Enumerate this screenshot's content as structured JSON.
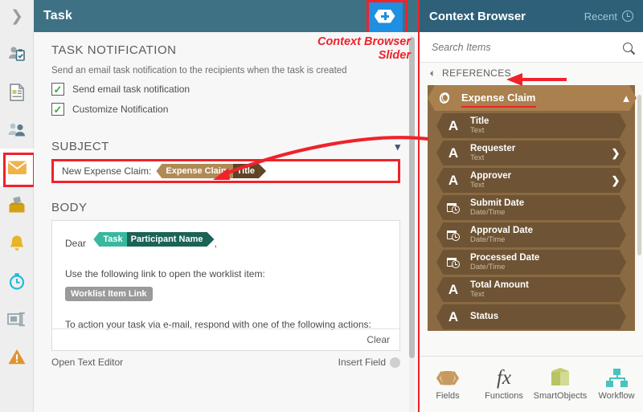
{
  "rail": {
    "collapse_icon": "chevron-right-icon",
    "items": [
      {
        "name": "users-tasks-icon",
        "label": "Users and Tasks",
        "selected": false
      },
      {
        "name": "form-icon",
        "label": "Form",
        "selected": false
      },
      {
        "name": "participants-icon",
        "label": "Participants",
        "selected": false
      },
      {
        "name": "email-icon",
        "label": "Email Notification",
        "selected": true
      },
      {
        "name": "inbox-icon",
        "label": "Inbox",
        "selected": false
      },
      {
        "name": "bell-icon",
        "label": "Reminders",
        "selected": false
      },
      {
        "name": "timer-icon",
        "label": "Escalations",
        "selected": false
      },
      {
        "name": "rules-icon",
        "label": "Rules",
        "selected": false
      },
      {
        "name": "warning-icon",
        "label": "Exceptions",
        "selected": false
      }
    ]
  },
  "main": {
    "title": "Task",
    "slider_icon": "hexagon-plus-icon",
    "notification": {
      "section_title": "TASK NOTIFICATION",
      "description": "Send an email task notification to the recipients when the task is created",
      "checkboxes": [
        {
          "label": "Send email task notification",
          "checked": true
        },
        {
          "label": "Customize Notification",
          "checked": true
        }
      ]
    },
    "subject": {
      "section_title": "SUBJECT",
      "collapse_icon": "chevron-down-icon",
      "text": "New Expense Claim:",
      "chip": {
        "left": "Expense Claim",
        "right": "Title"
      }
    },
    "body": {
      "section_title": "BODY",
      "greeting": "Dear",
      "greeting_chip": {
        "left": "Task",
        "right": "Participant Name"
      },
      "greeting_suffix": ",",
      "line_link_intro": "Use the following link to open the worklist item:",
      "link_button": "Worklist Item Link",
      "line_actions": "To action your task via e-mail, respond with one of the following actions:",
      "clear_label": "Clear"
    },
    "footer": {
      "open_text_editor": "Open Text Editor",
      "insert_field": "Insert Field"
    }
  },
  "context_browser": {
    "title": "Context Browser",
    "recent_label": "Recent",
    "recent_icon": "clock-icon",
    "search_placeholder": "Search Items",
    "search_value": "",
    "search_icon": "search-icon",
    "references_label": "REFERENCES",
    "references_toggle_icon": "triangle-collapse-icon",
    "group": {
      "name": "Expense Claim",
      "icon": "smartobject-icon",
      "caret_icon": "chevron-up-icon",
      "items": [
        {
          "name": "Title",
          "type": "Text",
          "icon": "text-a-icon",
          "has_caret": false
        },
        {
          "name": "Requester",
          "type": "Text",
          "icon": "text-a-icon",
          "has_caret": true
        },
        {
          "name": "Approver",
          "type": "Text",
          "icon": "text-a-icon",
          "has_caret": true
        },
        {
          "name": "Submit Date",
          "type": "Date/Time",
          "icon": "datetime-icon",
          "has_caret": false
        },
        {
          "name": "Approval Date",
          "type": "Date/Time",
          "icon": "datetime-icon",
          "has_caret": false
        },
        {
          "name": "Processed Date",
          "type": "Date/Time",
          "icon": "datetime-icon",
          "has_caret": false
        },
        {
          "name": "Total Amount",
          "type": "Text",
          "icon": "text-a-icon",
          "has_caret": false
        },
        {
          "name": "Status",
          "type": "",
          "icon": "text-a-icon",
          "has_caret": false
        }
      ]
    },
    "footer_tabs": [
      {
        "label": "Fields",
        "icon": "fields-hexagon-icon"
      },
      {
        "label": "Functions",
        "icon": "fx-icon"
      },
      {
        "label": "SmartObjects",
        "icon": "cube-icon"
      },
      {
        "label": "Workflow",
        "icon": "workflow-icon"
      }
    ]
  },
  "annotations": {
    "slider_callout": "Context Browser\nSlider",
    "accent_color": "#f0222a"
  }
}
